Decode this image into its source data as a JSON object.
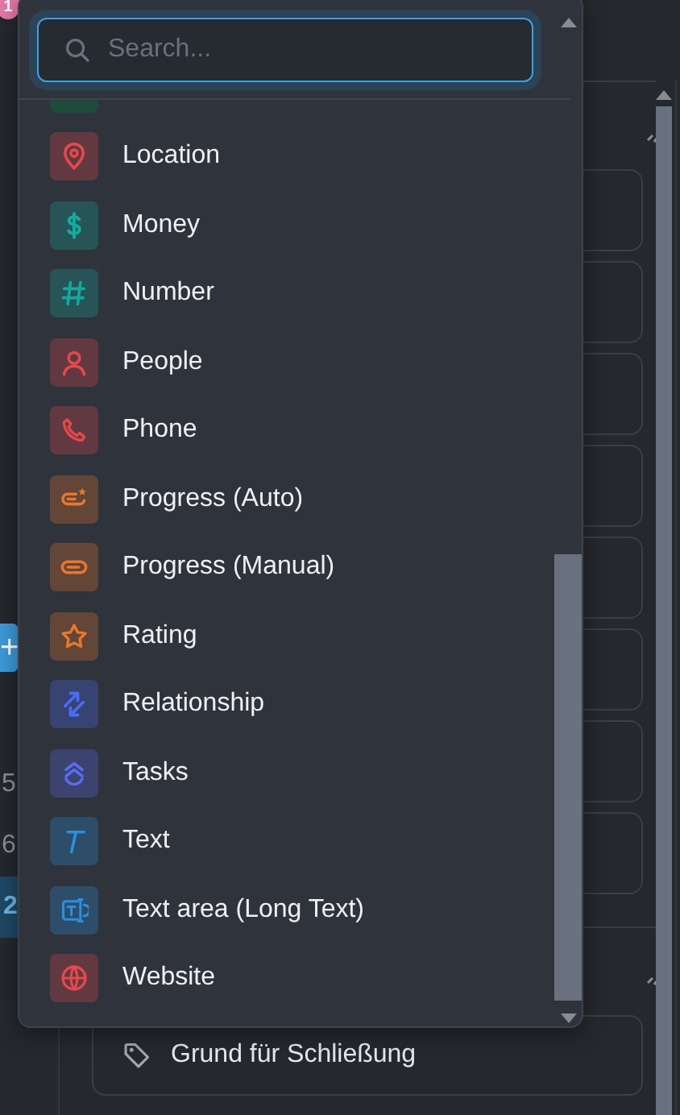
{
  "badge": {
    "text": "1"
  },
  "left_strip": {
    "add_button": "+",
    "numbers": [
      {
        "text": "5",
        "selected": false
      },
      {
        "text": "6",
        "selected": false
      },
      {
        "text": "2",
        "selected": true
      }
    ]
  },
  "dropdown": {
    "search": {
      "placeholder": "Search..."
    },
    "items": [
      {
        "label": "Location",
        "kind": "location",
        "color": "#e5484d"
      },
      {
        "label": "Money",
        "kind": "money",
        "color": "#14a8a0"
      },
      {
        "label": "Number",
        "kind": "number",
        "color": "#14a8a0"
      },
      {
        "label": "People",
        "kind": "people",
        "color": "#e5484d"
      },
      {
        "label": "Phone",
        "kind": "phone",
        "color": "#e5484d"
      },
      {
        "label": "Progress (Auto)",
        "kind": "progress-auto",
        "color": "#e8772e"
      },
      {
        "label": "Progress (Manual)",
        "kind": "progress-manual",
        "color": "#e8772e"
      },
      {
        "label": "Rating",
        "kind": "rating",
        "color": "#e8772e"
      },
      {
        "label": "Relationship",
        "kind": "relationship",
        "color": "#4a6cf7"
      },
      {
        "label": "Tasks",
        "kind": "tasks",
        "color": "#5b6cf0"
      },
      {
        "label": "Text",
        "kind": "text",
        "color": "#2b8fe0"
      },
      {
        "label": "Text area (Long Text)",
        "kind": "textarea",
        "color": "#2b8fe0"
      },
      {
        "label": "Website",
        "kind": "website",
        "color": "#e5484d"
      }
    ]
  },
  "panel": {
    "bottom_card": {
      "label": "Grund für Schließung"
    }
  }
}
